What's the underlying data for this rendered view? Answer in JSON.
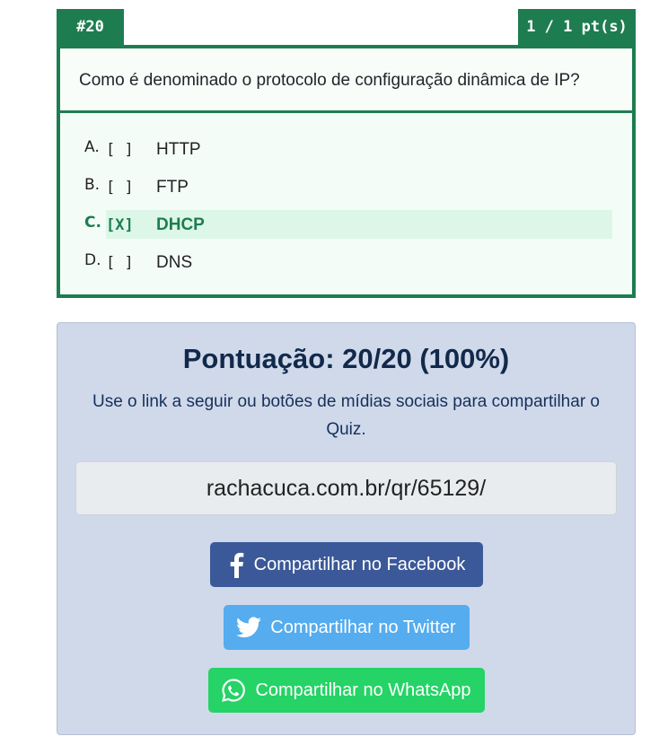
{
  "question": {
    "number": "#20",
    "score": "1 / 1 pt(s)",
    "text": "Como é denominado o protocolo de configuração dinâmica de IP?",
    "options": [
      {
        "letter": "A.",
        "mark": "[ ]",
        "text": "HTTP"
      },
      {
        "letter": "B.",
        "mark": "[ ]",
        "text": "FTP"
      },
      {
        "letter": "C.",
        "mark": "[X]",
        "text": "DHCP"
      },
      {
        "letter": "D.",
        "mark": "[ ]",
        "text": "DNS"
      }
    ]
  },
  "result": {
    "title": "Pontuação: 20/20 (100%)",
    "description": "Use o link a seguir ou botões de mídias sociais para compartilhar o Quiz.",
    "link": "rachacuca.com.br/qr/65129/",
    "buttons": {
      "facebook": "Compartilhar no Facebook",
      "twitter": "Compartilhar no Twitter",
      "whatsapp": "Compartilhar no WhatsApp"
    }
  },
  "colors": {
    "accent_green": "#1e7d50",
    "panel_bg": "#cfd9ea",
    "facebook": "#3b5998",
    "twitter": "#55acee",
    "whatsapp": "#25d366"
  },
  "icons": [
    "facebook-icon",
    "twitter-icon",
    "whatsapp-icon"
  ]
}
